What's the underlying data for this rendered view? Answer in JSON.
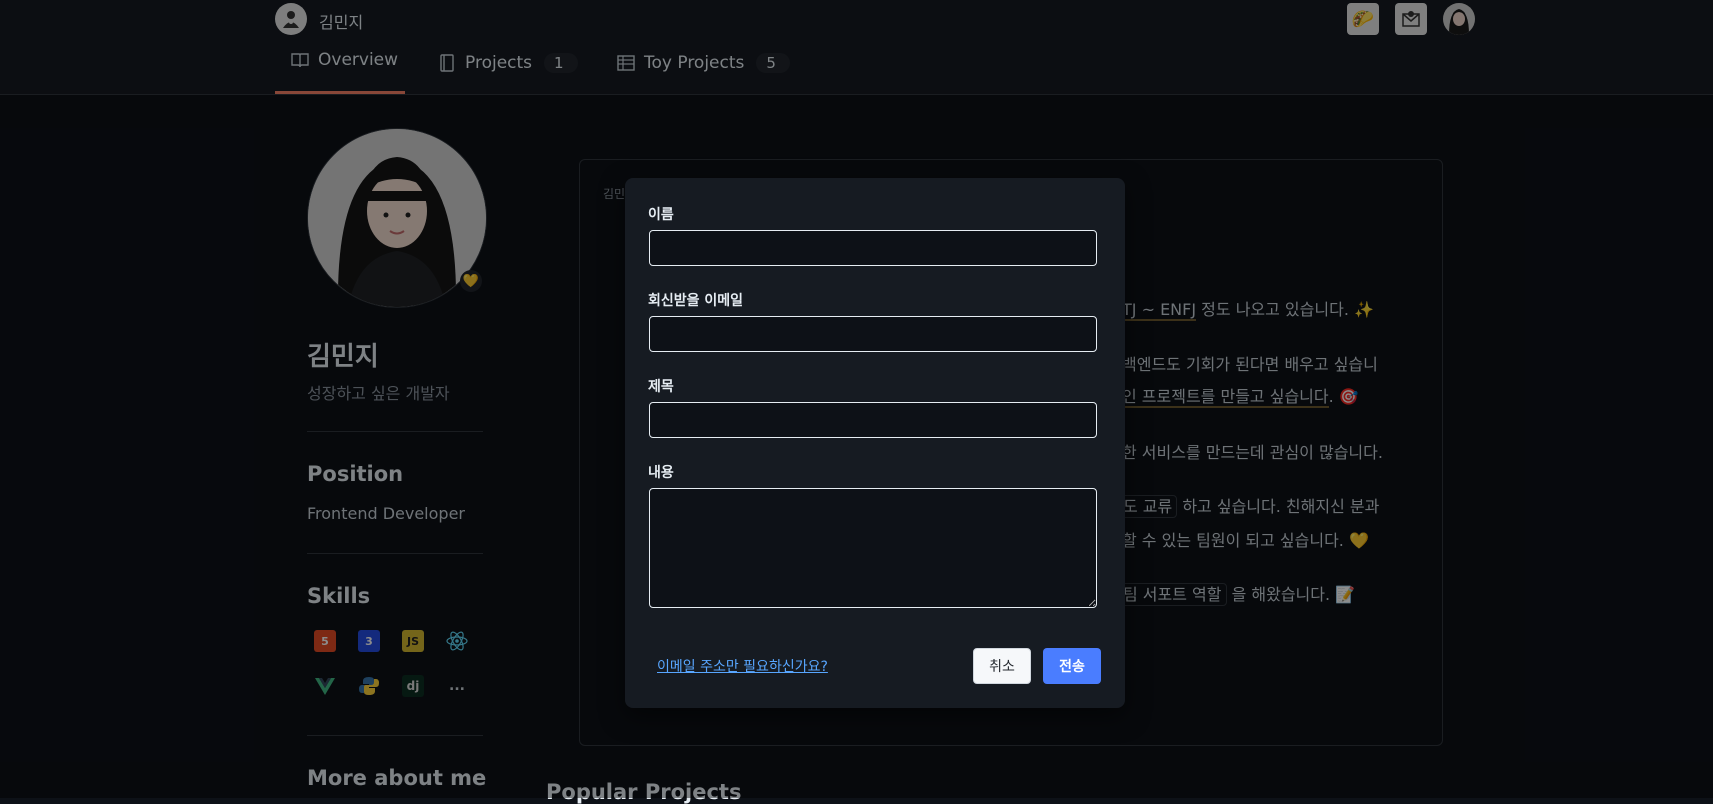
{
  "header": {
    "brand_name": "김민지",
    "icons": [
      "taco-icon",
      "mail-icon",
      "user-avatar"
    ]
  },
  "tabs": [
    {
      "label": "Overview",
      "icon": "book-icon",
      "active": true
    },
    {
      "label": "Projects",
      "icon": "repo-icon",
      "count": "1"
    },
    {
      "label": "Toy Projects",
      "icon": "table-icon",
      "count": "5"
    }
  ],
  "profile": {
    "name": "김민지",
    "bio": "성장하고 싶은 개발자",
    "status_emoji": "💛",
    "position_heading": "Position",
    "position_value": "Frontend Developer",
    "skills_heading": "Skills",
    "skills": [
      "html5-icon",
      "css3-icon",
      "javascript-icon",
      "react-icon",
      "vue-icon",
      "python-icon",
      "django-icon"
    ],
    "skills_more": "...",
    "more_heading": "More about me"
  },
  "readme": {
    "crumb": "김민",
    "line1_hl": "TJ ~ ENFJ",
    "line1_rest": " 정도 나오고 있습니다. ✨",
    "line2": "백엔드도 기회가 된다면 배우고 싶습니",
    "line3_hl": "인 프로젝트를 만들고 싶습니다",
    "line3_rest": ". 🎯",
    "line4": "한 서비스를 만드는데 관심이 많습니다.",
    "line5_hl": "도 교류",
    "line5_rest": " 하고 싶습니다. 친해지신 분과",
    "line6": "할 수 있는 팀원이 되고 싶습니다. 💛",
    "line7_hl": "팀 서포트 역할",
    "line7_rest": " 을 해왔습니다. 📝"
  },
  "popular_heading": "Popular Projects",
  "modal": {
    "name_label": "이름",
    "email_label": "회신받을 이메일",
    "subject_label": "제목",
    "content_label": "내용",
    "name_value": "",
    "email_value": "",
    "subject_value": "",
    "content_value": "",
    "email_only_link": "이메일 주소만 필요하신가요?",
    "cancel_label": "취소",
    "send_label": "전송"
  },
  "colors": {
    "background": "#0d1117",
    "header": "#161b22",
    "accent_tab": "#f78166",
    "send_button": "#4a7dff",
    "link": "#58a6ff"
  }
}
